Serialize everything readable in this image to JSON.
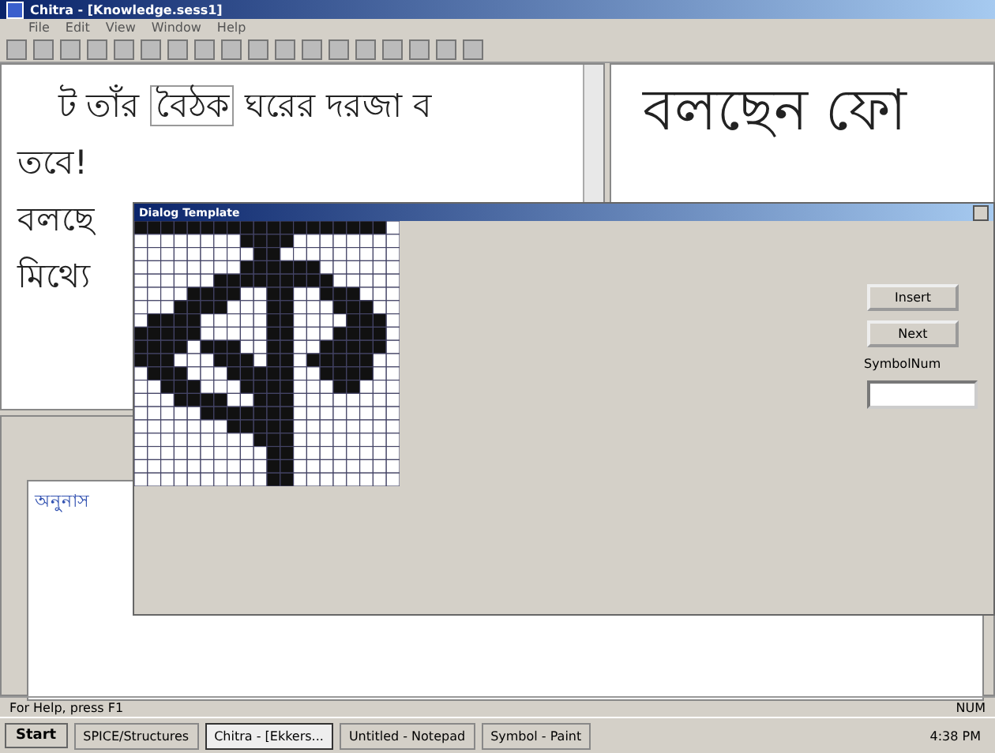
{
  "window": {
    "title": "Chitra - [Knowledge.sess1]"
  },
  "menu": [
    "File",
    "Edit",
    "View",
    "Window",
    "Help"
  ],
  "editor_left": {
    "lines": [
      {
        "parts": [
          {
            "text": "ট তাঁর",
            "boxed": false
          },
          {
            "text": "বৈঠক",
            "boxed": true
          },
          {
            "text": "ঘরের দরজা ব",
            "boxed": false
          }
        ]
      },
      {
        "parts": [
          {
            "text": "তবে!",
            "boxed": false
          }
        ]
      },
      {
        "parts": [
          {
            "text": "বলছে",
            "boxed": false
          }
        ]
      },
      {
        "parts": [
          {
            "text": "মিথ্যে",
            "boxed": false
          }
        ]
      }
    ]
  },
  "editor_right": {
    "text": "বলছেন ফো"
  },
  "output_pane": {
    "text": "অনুনাস"
  },
  "dialog": {
    "title": "Dialog Template",
    "buttons": [
      "Insert",
      "Next"
    ],
    "symbol_label": "SymbolNum"
  },
  "status_bar": {
    "message": "For Help, press F1",
    "indicator": "NUM"
  },
  "taskbar": {
    "start": "Start",
    "tasks": [
      {
        "label": "SPICE/Structures",
        "selected": false
      },
      {
        "label": "Chitra - [Ekkers...",
        "selected": true
      },
      {
        "label": "Untitled - Notepad",
        "selected": false
      },
      {
        "label": "Symbol - Paint",
        "selected": false
      }
    ],
    "clock": "4:38 PM"
  }
}
